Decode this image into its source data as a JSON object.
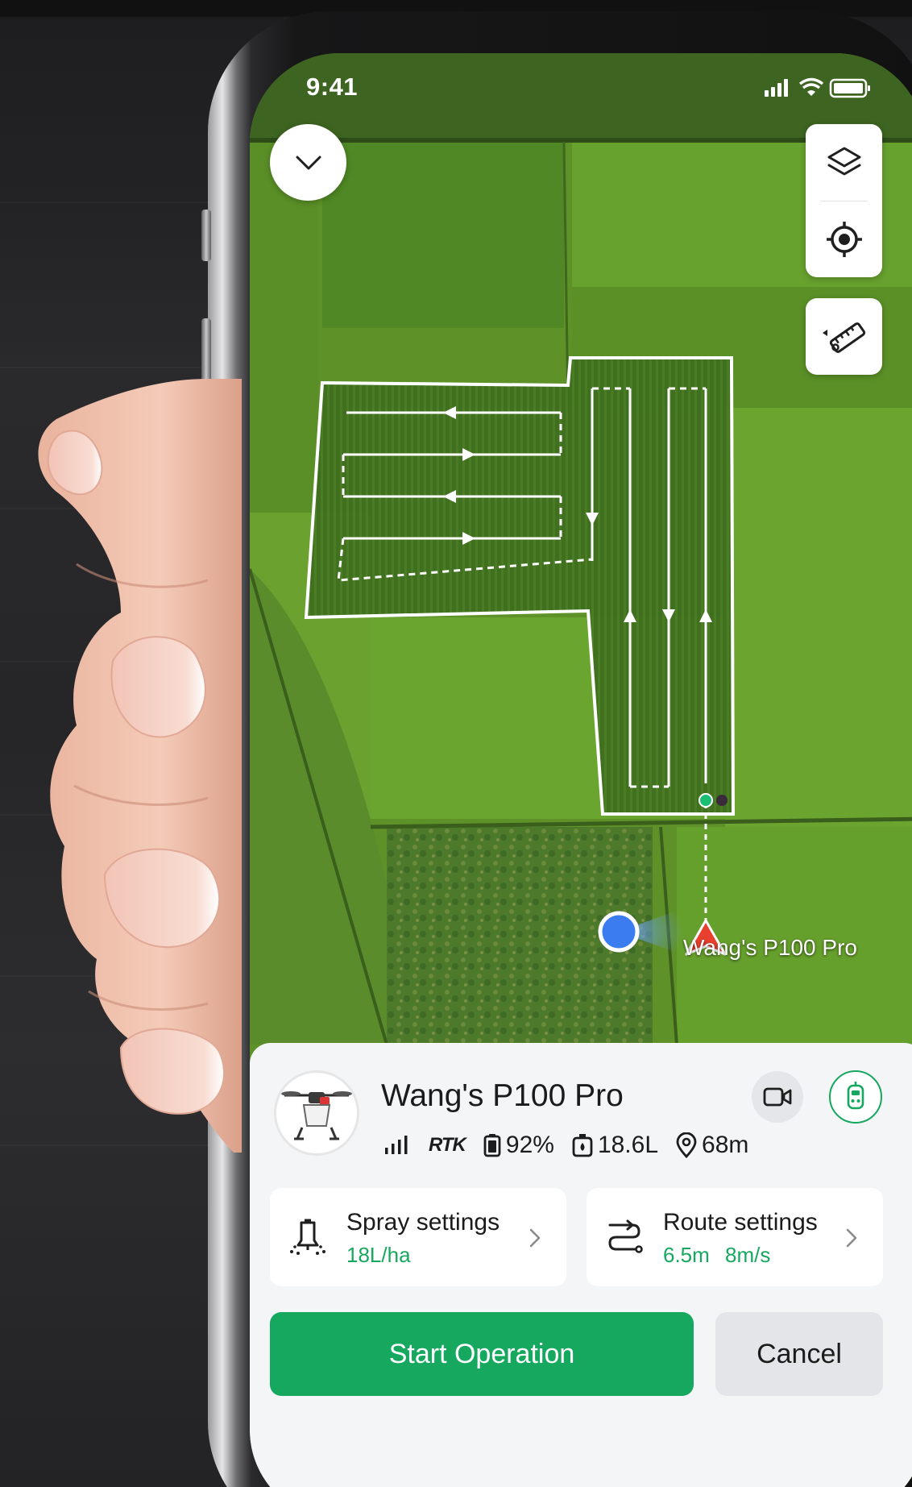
{
  "status_bar": {
    "time": "9:41",
    "icons": [
      "cellular-signal-icon",
      "wifi-icon",
      "battery-icon"
    ]
  },
  "map": {
    "controls": {
      "collapse_icon": "chevron-down-icon",
      "layers_icon": "layers-icon",
      "locate_icon": "locate-target-icon",
      "measure_icon": "ruler-icon"
    },
    "drone_label": "Wang's P100 Pro",
    "colors": {
      "route": "#ffffff",
      "drone_marker": "#e8402e",
      "user_marker": "#3b7df0",
      "start_point": "#1bbf74"
    }
  },
  "device": {
    "name": "Wang's P100 Pro",
    "signal_icon": "signal-bars-icon",
    "rtk_label": "RTK",
    "battery": "92%",
    "tank": "18.6L",
    "distance": "68m",
    "camera_icon": "video-camera-icon",
    "remote_icon": "remote-controller-icon"
  },
  "settings": {
    "spray": {
      "title": "Spray settings",
      "value": "18L/ha",
      "icon": "spray-nozzle-icon"
    },
    "route": {
      "title": "Route settings",
      "value1": "6.5m",
      "value2": "8m/s",
      "icon": "route-icon"
    }
  },
  "actions": {
    "start": "Start Operation",
    "cancel": "Cancel"
  },
  "theme": {
    "accent": "#17a860",
    "sheet_bg": "#f4f5f7"
  }
}
